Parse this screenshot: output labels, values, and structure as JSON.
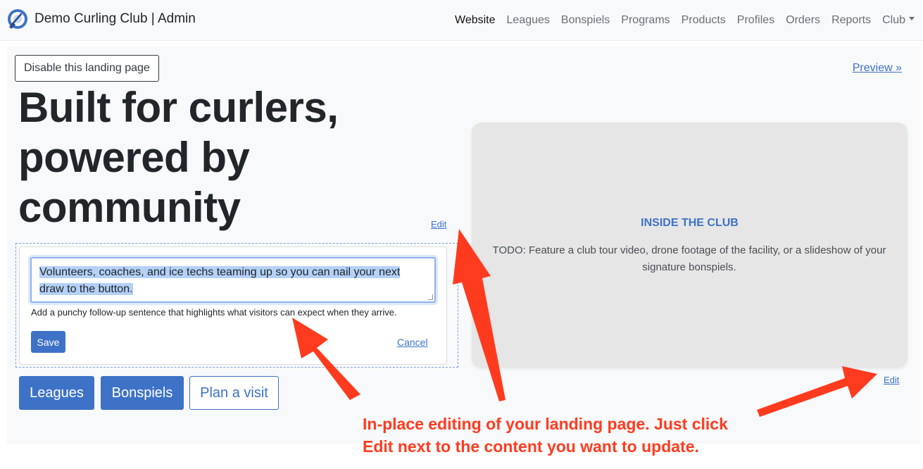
{
  "navbar": {
    "brand": "Demo Curling Club | Admin",
    "items": [
      {
        "label": "Website",
        "active": true
      },
      {
        "label": "Leagues"
      },
      {
        "label": "Bonspiels"
      },
      {
        "label": "Programs"
      },
      {
        "label": "Products"
      },
      {
        "label": "Profiles"
      },
      {
        "label": "Orders"
      },
      {
        "label": "Reports"
      },
      {
        "label": "Club"
      }
    ]
  },
  "toolbar": {
    "disable_label": "Disable this landing page",
    "preview_label": "Preview »"
  },
  "hero": {
    "headline_lines": [
      "Built for curlers,",
      "powered by",
      "community"
    ],
    "edit_label": "Edit"
  },
  "editor": {
    "value": "Volunteers, coaches, and ice techs teaming up so you can nail your next draw to the button.",
    "help": "Add a punchy follow-up sentence that highlights what visitors can expect when they arrive.",
    "save_label": "Save",
    "cancel_label": "Cancel"
  },
  "cta": {
    "leagues": "Leagues",
    "bonspiels": "Bonspiels",
    "plan": "Plan a visit"
  },
  "media": {
    "title": "INSIDE THE CLUB",
    "text": "TODO: Feature a club tour video, drone footage of the facility, or a slideshow of your signature bonspiels.",
    "edit_label": "Edit"
  },
  "annotation": {
    "line1": "In-place editing of your landing page. Just click",
    "line2": "Edit next to the content you want to update.",
    "color": "#ff3b1f"
  },
  "colors": {
    "accent": "#3e72c7",
    "navbar_bg": "#f8f9fa",
    "media_bg": "#e6e6e6"
  }
}
